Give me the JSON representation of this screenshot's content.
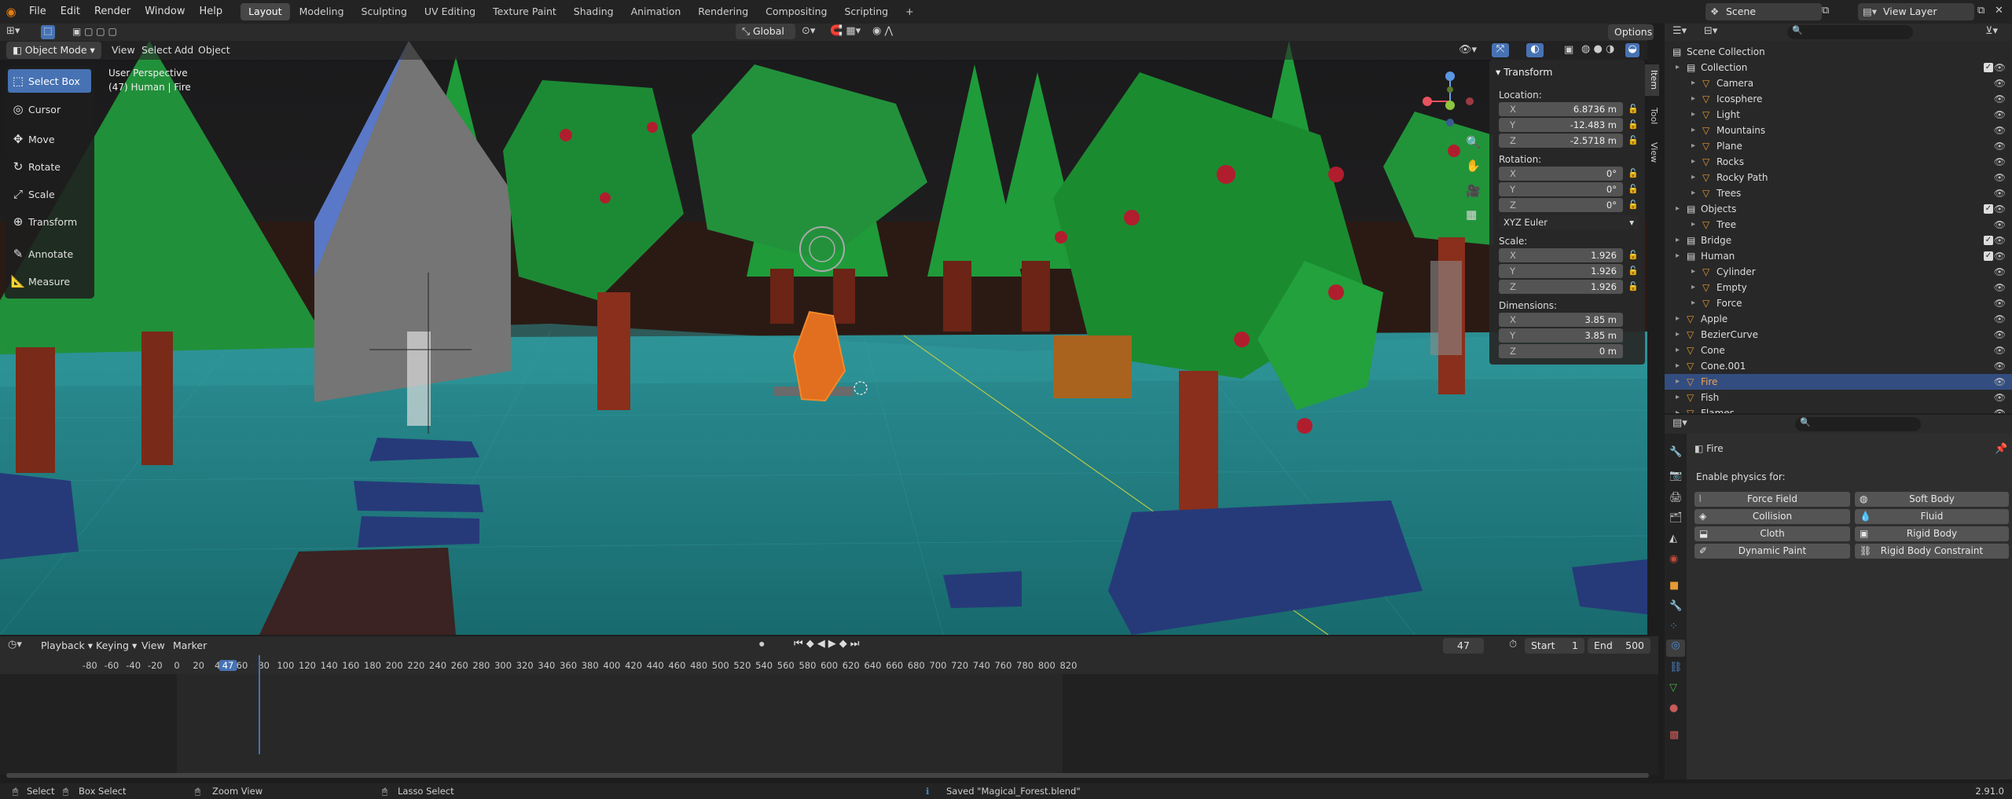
{
  "topbar": {
    "menus": [
      "File",
      "Edit",
      "Render",
      "Window",
      "Help"
    ],
    "workspaces": [
      "Layout",
      "Modeling",
      "Sculpting",
      "UV Editing",
      "Texture Paint",
      "Shading",
      "Animation",
      "Rendering",
      "Compositing",
      "Scripting"
    ],
    "active_workspace": "Layout",
    "add_tab": "+",
    "scene": "Scene",
    "view_layer": "View Layer"
  },
  "viewport_header": {
    "transform_orientation": "Global",
    "options": "Options",
    "mode": "Object Mode",
    "menus": [
      "View",
      "Select",
      "Add",
      "Object"
    ]
  },
  "viewport": {
    "perspective": "User Perspective",
    "object_info": "(47) Human | Fire"
  },
  "tools": [
    "Select Box",
    "Cursor",
    "Move",
    "Rotate",
    "Scale",
    "Transform",
    "Annotate",
    "Measure"
  ],
  "npanel": {
    "title": "Transform",
    "location_label": "Location:",
    "location": [
      "6.8736 m",
      "-12.483 m",
      "-2.5718 m"
    ],
    "rotation_label": "Rotation:",
    "rotation": [
      "0°",
      "0°",
      "0°"
    ],
    "rotation_mode": "XYZ Euler",
    "scale_label": "Scale:",
    "scale": [
      "1.926",
      "1.926",
      "1.926"
    ],
    "dimensions_label": "Dimensions:",
    "dimensions": [
      "3.85 m",
      "3.85 m",
      "0 m"
    ],
    "axes": [
      "X",
      "Y",
      "Z"
    ],
    "tabs": [
      "Item",
      "Tool",
      "View"
    ]
  },
  "outliner": {
    "root": "Scene Collection",
    "rows": [
      {
        "name": "Collection",
        "depth": 1,
        "check": true
      },
      {
        "name": "Camera",
        "depth": 2
      },
      {
        "name": "Icosphere",
        "depth": 2
      },
      {
        "name": "Light",
        "depth": 2
      },
      {
        "name": "Mountains",
        "depth": 2
      },
      {
        "name": "Plane",
        "depth": 2
      },
      {
        "name": "Rocks",
        "depth": 2
      },
      {
        "name": "Rocky Path",
        "depth": 2
      },
      {
        "name": "Trees",
        "depth": 2
      },
      {
        "name": "Objects",
        "depth": 1,
        "check": true
      },
      {
        "name": "Tree",
        "depth": 2
      },
      {
        "name": "Bridge",
        "depth": 1,
        "check": true
      },
      {
        "name": "Human",
        "depth": 1,
        "check": true
      },
      {
        "name": "Cylinder",
        "depth": 2
      },
      {
        "name": "Empty",
        "depth": 2
      },
      {
        "name": "Force",
        "depth": 2
      },
      {
        "name": "Apple",
        "depth": 1
      },
      {
        "name": "BezierCurve",
        "depth": 1
      },
      {
        "name": "Cone",
        "depth": 1
      },
      {
        "name": "Cone.001",
        "depth": 1
      },
      {
        "name": "Fire",
        "depth": 1,
        "selected": true
      },
      {
        "name": "Fish",
        "depth": 1
      },
      {
        "name": "Flames",
        "depth": 1
      }
    ]
  },
  "properties": {
    "object": "Fire",
    "physics_heading": "Enable physics for:",
    "buttons_left": [
      "Force Field",
      "Collision",
      "Cloth",
      "Dynamic Paint"
    ],
    "buttons_right": [
      "Soft Body",
      "Fluid",
      "Rigid Body",
      "Rigid Body Constraint"
    ]
  },
  "timeline": {
    "menus": [
      "Playback",
      "Keying",
      "View",
      "Marker"
    ],
    "current_frame": "47",
    "start_label": "Start",
    "start": "1",
    "end_label": "End",
    "end": "500",
    "ticks": [
      "-80",
      "-60",
      "-40",
      "-20",
      "0",
      "20",
      "40",
      "47",
      "60",
      "80",
      "100",
      "120",
      "140",
      "160",
      "180",
      "200",
      "220",
      "240",
      "260",
      "280",
      "300",
      "320",
      "340",
      "360",
      "380",
      "400",
      "420",
      "440",
      "460",
      "480",
      "500",
      "520",
      "540",
      "560",
      "580",
      "600",
      "620",
      "640",
      "660",
      "680",
      "700",
      "720",
      "740",
      "760",
      "780",
      "800",
      "820"
    ]
  },
  "statusbar": {
    "select": "Select",
    "box_select": "Box Select",
    "zoom": "Zoom View",
    "lasso": "Lasso Select",
    "message": "Saved \"Magical_Forest.blend\"",
    "version": "2.91.0"
  },
  "colors": {
    "accent": "#4772b3",
    "selected_row": "#334d80",
    "ground": "#1f8f8f",
    "tree_green": "#1d8c2e",
    "trunk": "#8a2f1b"
  }
}
